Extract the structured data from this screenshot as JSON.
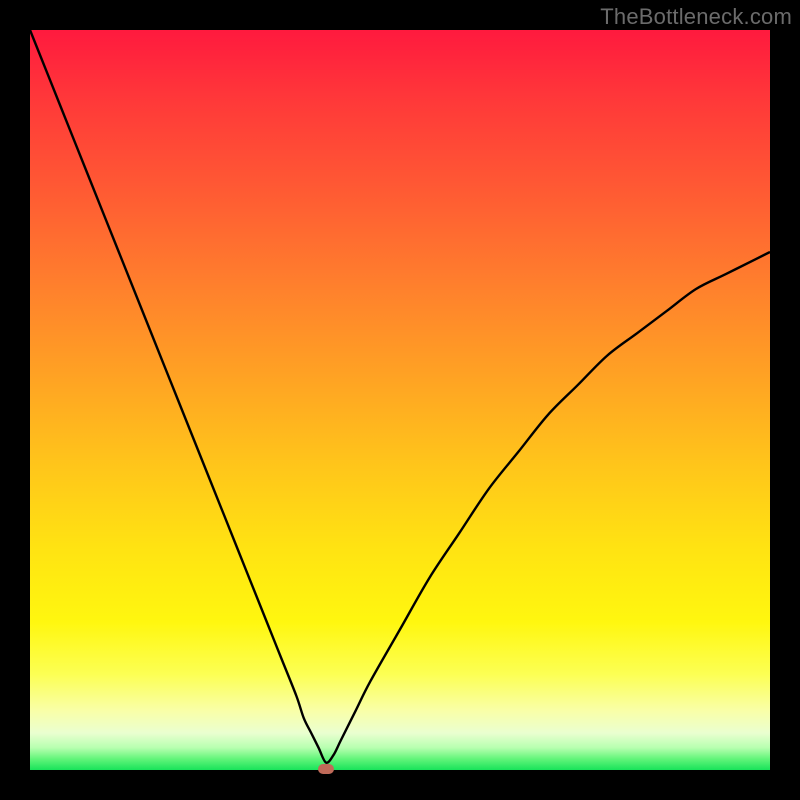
{
  "watermark": "TheBottleneck.com",
  "colors": {
    "frame": "#000000",
    "curve": "#000000",
    "marker": "#c06a59",
    "gradient_top": "#ff1a3e",
    "gradient_bottom": "#18e35a"
  },
  "chart_data": {
    "type": "line",
    "title": "",
    "xlabel": "",
    "ylabel": "",
    "xlim": [
      0,
      100
    ],
    "ylim": [
      0,
      100
    ],
    "grid": false,
    "legend": false,
    "annotations": [
      {
        "text": "TheBottleneck.com",
        "position": "top-right"
      }
    ],
    "marker": {
      "x": 40,
      "y": 0
    },
    "series": [
      {
        "name": "bottleneck-curve",
        "x": [
          0,
          4,
          8,
          12,
          16,
          20,
          24,
          28,
          32,
          34,
          36,
          37,
          38,
          39,
          40,
          41,
          42,
          44,
          46,
          50,
          54,
          58,
          62,
          66,
          70,
          74,
          78,
          82,
          86,
          90,
          94,
          98,
          100
        ],
        "y": [
          100,
          90,
          80,
          70,
          60,
          50,
          40,
          30,
          20,
          15,
          10,
          7,
          5,
          3,
          1,
          2,
          4,
          8,
          12,
          19,
          26,
          32,
          38,
          43,
          48,
          52,
          56,
          59,
          62,
          65,
          67,
          69,
          70
        ]
      }
    ]
  }
}
